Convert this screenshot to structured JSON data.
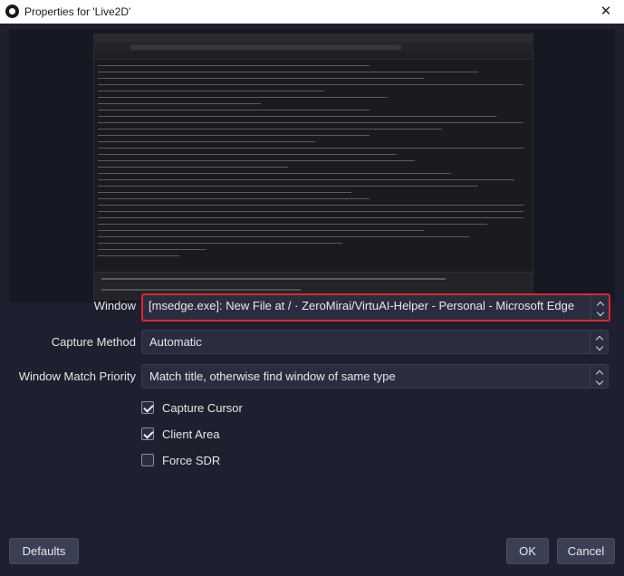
{
  "window": {
    "title": "Properties for 'Live2D'",
    "app_icon": "obs-icon",
    "close_glyph": "✕"
  },
  "preview": {
    "description_icon": "captured-window-preview"
  },
  "form": {
    "window_label": "Window",
    "window_value": "[msedge.exe]: New File at / · ZeroMirai/VirtuAI-Helper - Personal - Microsoft Edge",
    "capture_method_label": "Capture Method",
    "capture_method_value": "Automatic",
    "match_priority_label": "Window Match Priority",
    "match_priority_value": "Match title, otherwise find window of same type"
  },
  "options": [
    {
      "label": "Capture Cursor",
      "checked": true
    },
    {
      "label": "Client Area",
      "checked": true
    },
    {
      "label": "Force SDR",
      "checked": false
    }
  ],
  "buttons": {
    "defaults": "Defaults",
    "ok": "OK",
    "cancel": "Cancel"
  },
  "colors": {
    "background": "#1e2030",
    "highlight": "#e0262e"
  }
}
